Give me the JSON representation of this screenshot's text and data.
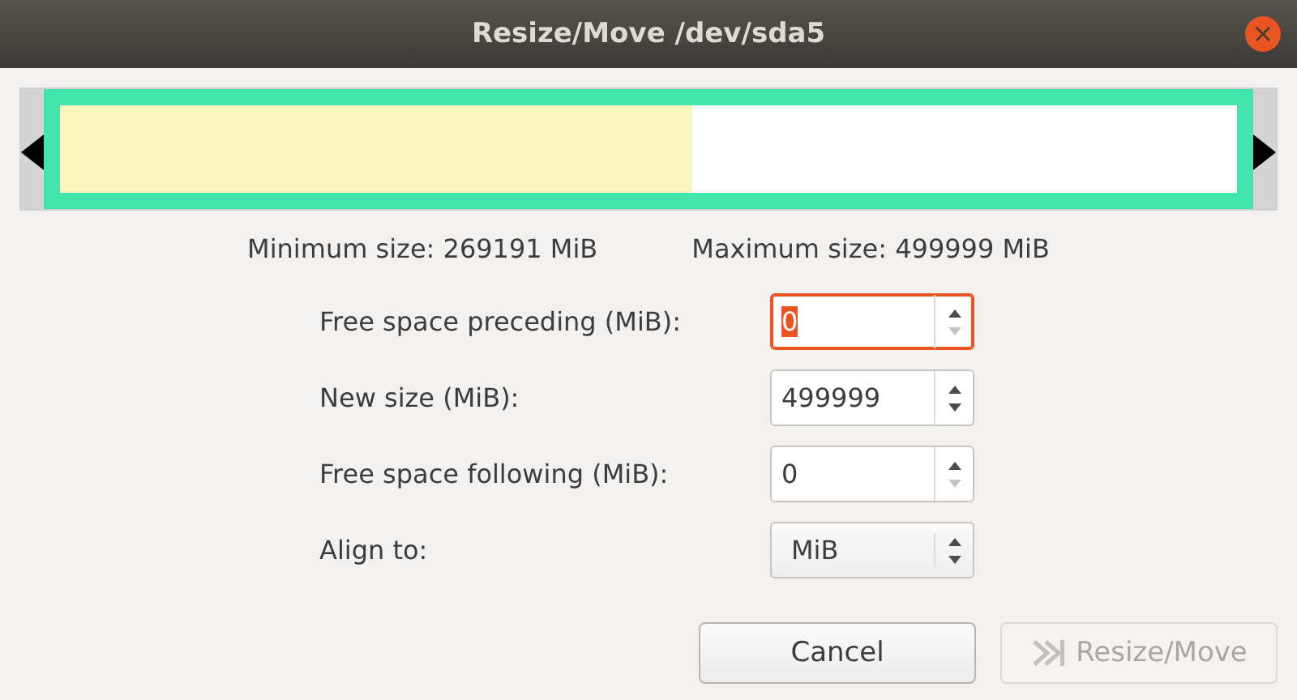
{
  "window": {
    "title": "Resize/Move /dev/sda5",
    "close_symbol": "×"
  },
  "partition": {
    "level": 0.537
  },
  "sizes": {
    "minimum": "Minimum size: 269191 MiB",
    "maximum": "Maximum size: 499999 MiB"
  },
  "fields": [
    {
      "kind": "spin",
      "label": "Free space preceding (MiB):",
      "value": "0",
      "focused": true,
      "down_disabled": true
    },
    {
      "kind": "spin",
      "label": "New size (MiB):",
      "value": "499999",
      "focused": false,
      "down_disabled": false
    },
    {
      "kind": "spin",
      "label": "Free space following (MiB):",
      "value": "0",
      "focused": false,
      "down_disabled": true
    },
    {
      "kind": "combo",
      "label": "Align to:",
      "value": "MiB",
      "focused": false,
      "down_disabled": false
    }
  ],
  "buttons": [
    {
      "label": "Cancel",
      "disabled": false,
      "icon": false
    },
    {
      "label": "Resize/Move",
      "disabled": true,
      "icon": true
    }
  ]
}
